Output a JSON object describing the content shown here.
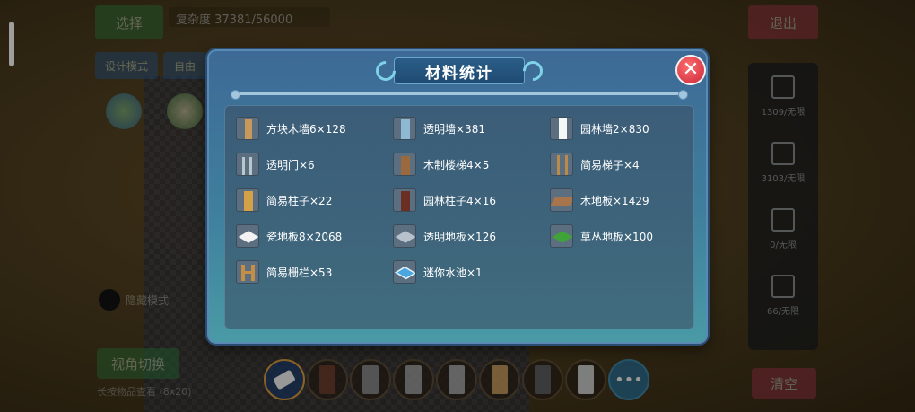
{
  "background": {
    "select_label": "选择",
    "capacity_text": "复杂度 37381/56000",
    "design_label": "设计模式",
    "free_label": "自由",
    "exit_label": "退出",
    "clear_label": "清空",
    "switch_label": "视角切换",
    "left_round_label": "隐藏模式",
    "bottom_note": "长按物品查看 (8x20)",
    "right_panel": [
      {
        "label": "1309/无限"
      },
      {
        "label": "3103/无限"
      },
      {
        "label": "0/无限"
      },
      {
        "label": "66/无限"
      }
    ],
    "more_label": "•••"
  },
  "modal": {
    "title": "材料统计",
    "close_glyph": "✕",
    "materials": [
      {
        "label": "方块木墙6×128",
        "icon": "wood-block-wall-icon",
        "color": "#c79a5b"
      },
      {
        "label": "透明墙×381",
        "icon": "transparent-wall-icon",
        "color": "#8fb9d2"
      },
      {
        "label": "园林墙2×830",
        "icon": "garden-wall-icon",
        "color": "#f4f8f6"
      },
      {
        "label": "透明门×6",
        "icon": "transparent-door-icon",
        "color": "#b9c6cd"
      },
      {
        "label": "木制楼梯4×5",
        "icon": "wooden-stairs-icon",
        "color": "#9a6a3e"
      },
      {
        "label": "简易梯子×4",
        "icon": "simple-ladder-icon",
        "color": "#b98a4a"
      },
      {
        "label": "简易柱子×22",
        "icon": "simple-pillar-icon",
        "color": "#d3a148"
      },
      {
        "label": "园林柱子4×16",
        "icon": "garden-pillar-icon",
        "color": "#6a2f22"
      },
      {
        "label": "木地板×1429",
        "icon": "wood-floor-icon",
        "color": "#a7744c"
      },
      {
        "label": "瓷地板8×2068",
        "icon": "porcelain-floor-icon",
        "color": "#f2f2f2"
      },
      {
        "label": "透明地板×126",
        "icon": "transparent-floor-icon",
        "color": "#b7c2cc"
      },
      {
        "label": "草丛地板×100",
        "icon": "grass-floor-icon",
        "color": "#3fa33a"
      },
      {
        "label": "简易栅栏×53",
        "icon": "simple-fence-icon",
        "color": "#c58e45"
      },
      {
        "label": "迷你水池×1",
        "icon": "mini-pool-icon",
        "color": "#4aa6e0"
      }
    ]
  }
}
